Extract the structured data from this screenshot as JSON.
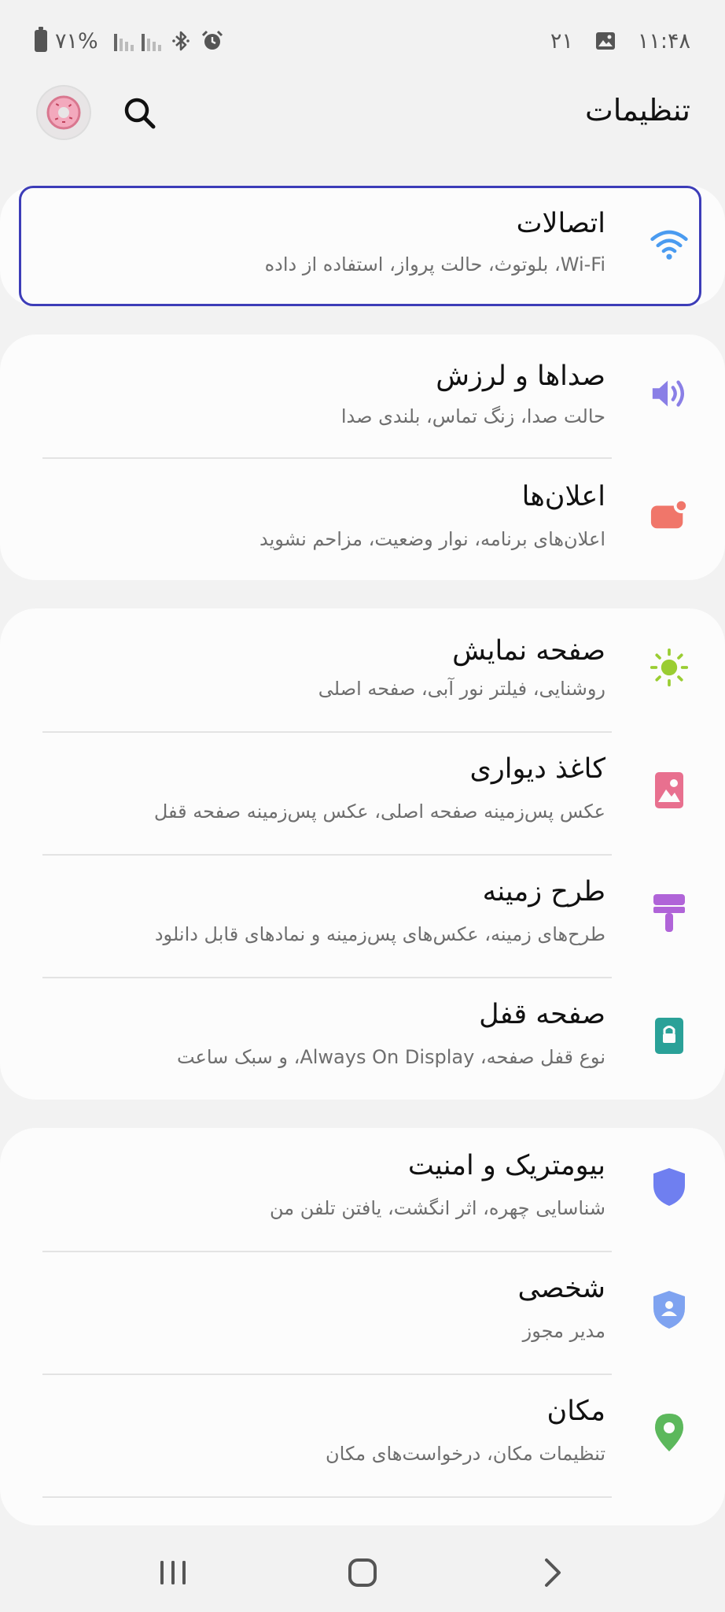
{
  "status_bar": {
    "battery": "٧١%",
    "date": "٢١",
    "time": "١١:۴٨"
  },
  "header": {
    "title": "تنظیمات"
  },
  "groups": [
    {
      "items": [
        {
          "title": "اتصالات",
          "subtitle": "Wi-Fi، بلوتوث، حالت پرواز، استفاده از داده",
          "icon": "wifi-icon",
          "color": "#4a9bf0",
          "focused": true
        }
      ]
    },
    {
      "items": [
        {
          "title": "صداها و لرزش",
          "subtitle": "حالت صدا، زنگ تماس، بلندی صدا",
          "icon": "volume-icon",
          "color": "#8a7fe6"
        },
        {
          "title": "اعلان‌ها",
          "subtitle": "اعلان‌های برنامه، نوار وضعیت، مزاحم نشوید",
          "icon": "notification-icon",
          "color": "#f0766a"
        }
      ]
    },
    {
      "items": [
        {
          "title": "صفحه نمایش",
          "subtitle": "روشنایی، فیلتر نور آبی، صفحه اصلی",
          "icon": "brightness-icon",
          "color": "#9acd32"
        },
        {
          "title": "کاغذ دیواری",
          "subtitle": "عکس پس‌زمینه صفحه اصلی، عکس پس‌زمینه صفحه قفل",
          "icon": "wallpaper-icon",
          "color": "#e8708f"
        },
        {
          "title": "طرح زمینه",
          "subtitle": "طرح‌های زمینه، عکس‌های پس‌زمینه و نمادهای قابل دانلود",
          "icon": "theme-brush-icon",
          "color": "#b064d8"
        },
        {
          "title": "صفحه قفل",
          "subtitle": "نوع قفل صفحه، Always On Display، و سبک ساعت",
          "icon": "lock-icon",
          "color": "#2aa198"
        }
      ]
    },
    {
      "items": [
        {
          "title": "بیومتریک و امنیت",
          "subtitle": "شناسایی چهره، اثر انگشت، یافتن تلفن من",
          "icon": "shield-icon",
          "color": "#6f7ff0"
        },
        {
          "title": "شخصی",
          "subtitle": "مدیر مجوز",
          "icon": "privacy-shield-icon",
          "color": "#7fa3f0"
        },
        {
          "title": "مکان",
          "subtitle": "تنظیمات مکان، درخواست‌های مکان",
          "icon": "location-pin-icon",
          "color": "#5cb85c"
        }
      ]
    }
  ],
  "nav": {
    "recents": "recents-icon",
    "home": "home-icon",
    "back": "back-icon"
  }
}
